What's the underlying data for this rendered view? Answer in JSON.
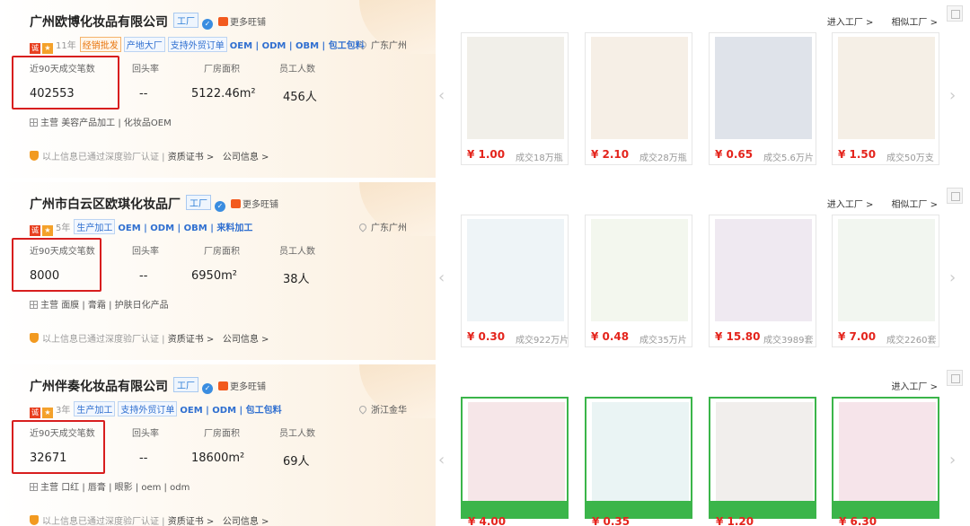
{
  "colors": {
    "accent": "#d81e1e",
    "price": "#e4241c",
    "link": "#2f6fd0",
    "green_banner": "#3bb54a"
  },
  "labels": {
    "stat1": "近90天成交笔数",
    "stat2": "回头率",
    "stat3": "厂房面积",
    "stat4": "员工人数",
    "main_prefix": "主营",
    "verify": "以上信息已通过深度验厂认证 |",
    "cert": "资质证书 >",
    "info": "公司信息 >",
    "enter": "进入工厂 >",
    "similar": "相似工厂 >",
    "factory_tag": "工厂",
    "shop": "更多旺铺"
  },
  "icons": [
    "verified-badge-icon",
    "gold-badge-icon",
    "shop-icon",
    "location-pin-icon",
    "grid-icon",
    "shield-icon",
    "chevron-left-icon",
    "chevron-right-icon"
  ],
  "companies": [
    {
      "name": "广州欧博化妆品有限公司",
      "years": "11年",
      "tags": [
        "经销批发",
        "产地大厂",
        "支持外贸订单"
      ],
      "tags_orange": [
        0
      ],
      "plain": "OEM | ODM | OBM | 包工包料",
      "location": "广东广州",
      "deals": "402553",
      "repeat": "--",
      "area": "5122.46m²",
      "staff": "456人",
      "main": "美容产品加工 | 化妆品OEM",
      "show_similar": true,
      "products": [
        {
          "price": "¥ 1.00",
          "sold": "成交18万瓶"
        },
        {
          "price": "¥ 2.10",
          "sold": "成交28万瓶"
        },
        {
          "price": "¥ 0.65",
          "sold": "成交5.6万片"
        },
        {
          "price": "¥ 1.50",
          "sold": "成交50万支"
        }
      ]
    },
    {
      "name": "广州市白云区欧琪化妆品厂",
      "years": "5年",
      "tags": [
        "生产加工"
      ],
      "tags_orange": [],
      "plain": "OEM | ODM | OBM | 来料加工",
      "location": "广东广州",
      "deals": "8000",
      "repeat": "--",
      "area": "6950m²",
      "staff": "38人",
      "main": "面膜 | 膏霜 | 护肤日化产品",
      "show_similar": true,
      "products": [
        {
          "price": "¥ 0.30",
          "sold": "成交922万片"
        },
        {
          "price": "¥ 0.48",
          "sold": "成交35万片"
        },
        {
          "price": "¥ 15.80",
          "sold": "成交3989套"
        },
        {
          "price": "¥ 7.00",
          "sold": "成交2260套"
        }
      ]
    },
    {
      "name": "广州伴奏化妆品有限公司",
      "years": "3年",
      "tags": [
        "生产加工",
        "支持外贸订单"
      ],
      "tags_orange": [],
      "plain": "OEM | ODM | 包工包料",
      "location": "浙江金华",
      "deals": "32671",
      "repeat": "--",
      "area": "18600m²",
      "staff": "69人",
      "main": "口红 | 唇膏 | 眼影 | oem | odm",
      "show_similar": false,
      "products": [
        {
          "price": "¥ 4.00",
          "sold": ""
        },
        {
          "price": "¥ 0.35",
          "sold": ""
        },
        {
          "price": "¥ 1.20",
          "sold": ""
        },
        {
          "price": "¥ 6.30",
          "sold": ""
        }
      ]
    }
  ]
}
